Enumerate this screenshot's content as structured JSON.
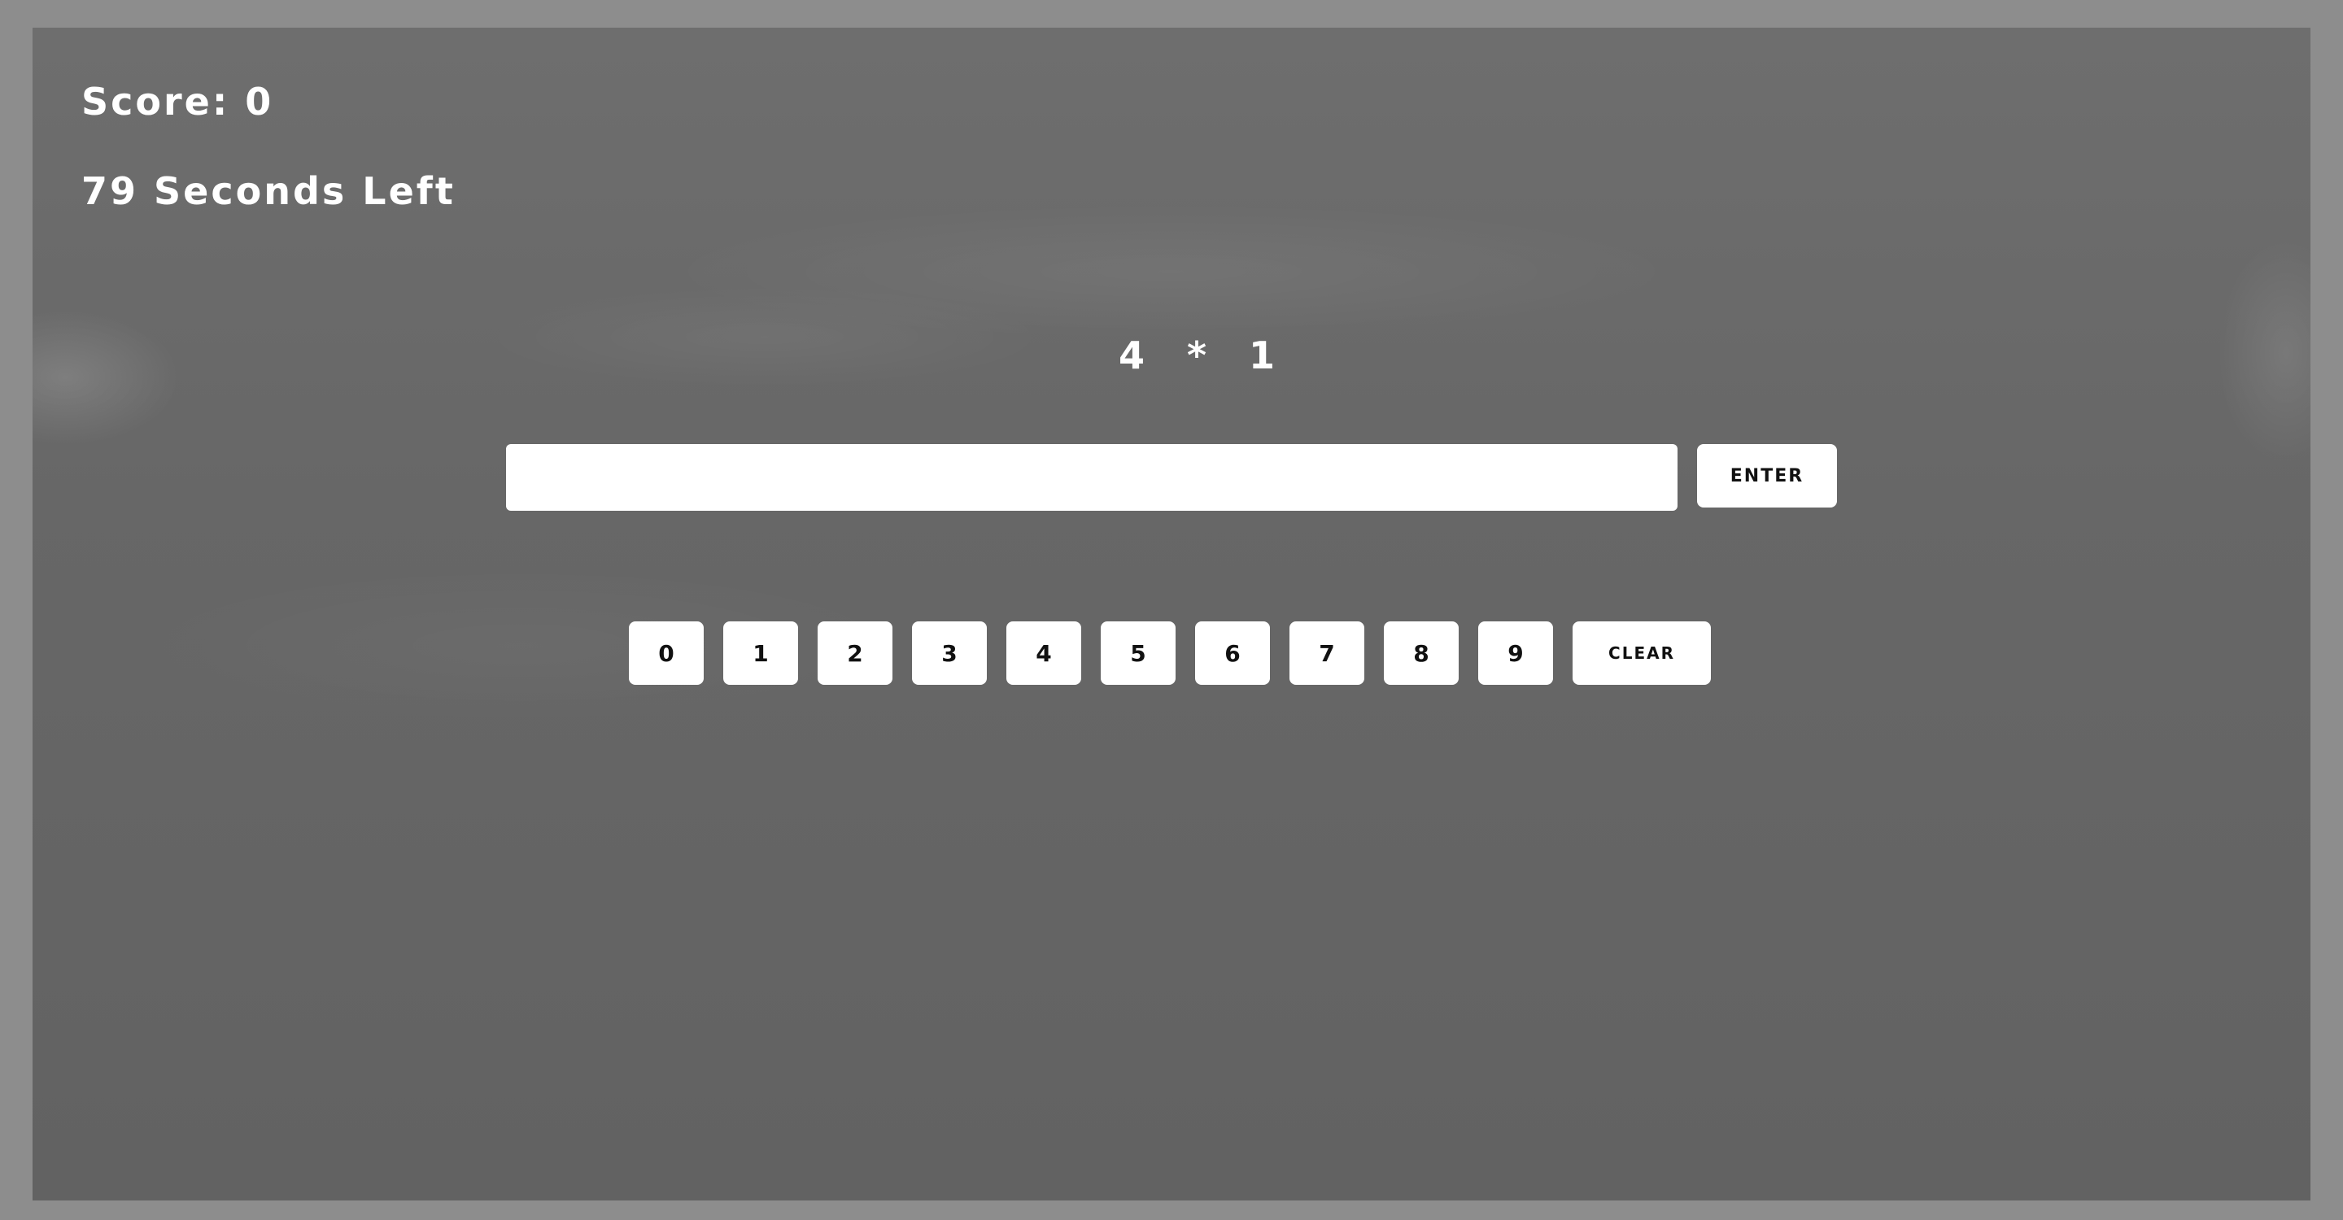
{
  "hud": {
    "score_text": "Score: 0",
    "timer_text": "79 Seconds Left"
  },
  "problem": {
    "text": "4 * 1"
  },
  "answer": {
    "value": "",
    "placeholder": ""
  },
  "buttons": {
    "enter_label": "ENTER",
    "clear_label": "CLEAR"
  },
  "keypad": {
    "keys": [
      "0",
      "1",
      "2",
      "3",
      "4",
      "5",
      "6",
      "7",
      "8",
      "9"
    ]
  },
  "colors": {
    "board": "#686868",
    "frame": "#8d8d8d",
    "chalk": "#ffffff",
    "button_bg": "#ffffff",
    "button_text": "#111111"
  }
}
